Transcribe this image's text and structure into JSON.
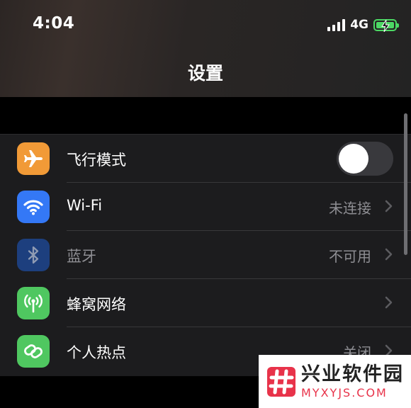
{
  "status_bar": {
    "time": "4:04",
    "network": "4G",
    "signal_bars": 4,
    "battery_state": "charging"
  },
  "header": {
    "title": "设置"
  },
  "settings": {
    "rows": [
      {
        "label": "飞行模式",
        "value": "",
        "icon": "airplane-icon",
        "icon_color": "#f19a37",
        "toggle_on": false
      },
      {
        "label": "Wi-Fi",
        "value": "未连接",
        "icon": "wifi-icon",
        "icon_color": "#3478f6"
      },
      {
        "label": "蓝牙",
        "value": "不可用",
        "icon": "bluetooth-icon",
        "icon_color": "#1d3f7e",
        "disabled": true
      },
      {
        "label": "蜂窝网络",
        "value": "",
        "icon": "cellular-antenna-icon",
        "icon_color": "#4fc760"
      },
      {
        "label": "个人热点",
        "value": "关闭",
        "icon": "hotspot-chain-icon",
        "icon_color": "#4fc760"
      }
    ]
  },
  "watermark": {
    "cn": "兴业软件园",
    "en": "MYXYJS.COM"
  },
  "colors": {
    "background": "#000000",
    "group_background": "#1c1c1e",
    "secondary_text": "#8e8e93",
    "battery": "#4cd964"
  }
}
